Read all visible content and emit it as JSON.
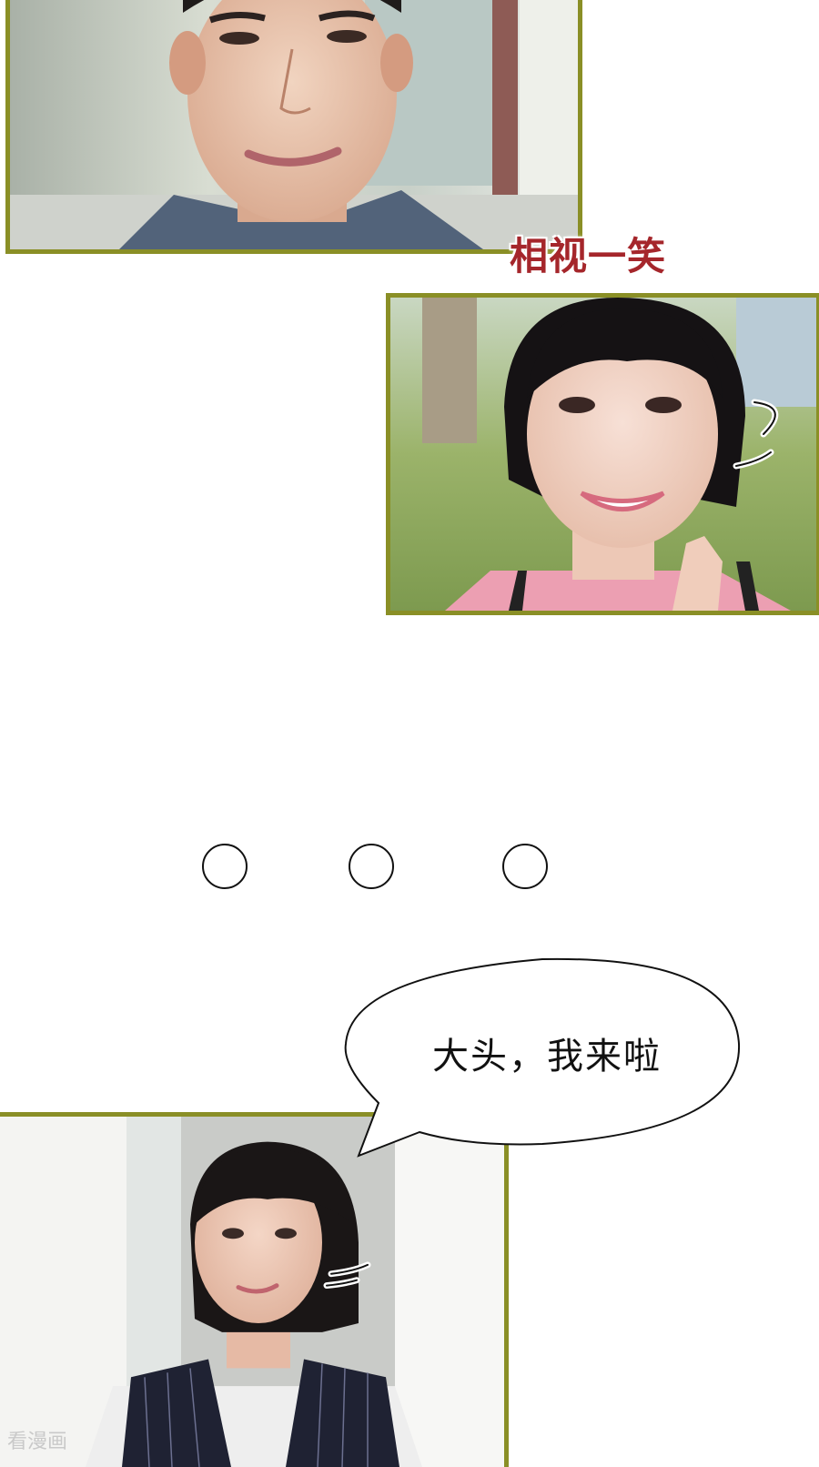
{
  "panels": [
    {
      "subject": "man-smiling-closeup"
    },
    {
      "subject": "woman-smiling-outdoors"
    },
    {
      "subject": "woman-short-hair-indoors"
    }
  ],
  "caption": {
    "text": "相视一笑",
    "color": "#a5262b"
  },
  "speech_bubble": {
    "text": "大头，我来啦"
  },
  "watermark": {
    "text": "看漫画"
  },
  "colors": {
    "panel_border": "#8a8f26",
    "background": "#ffffff"
  }
}
